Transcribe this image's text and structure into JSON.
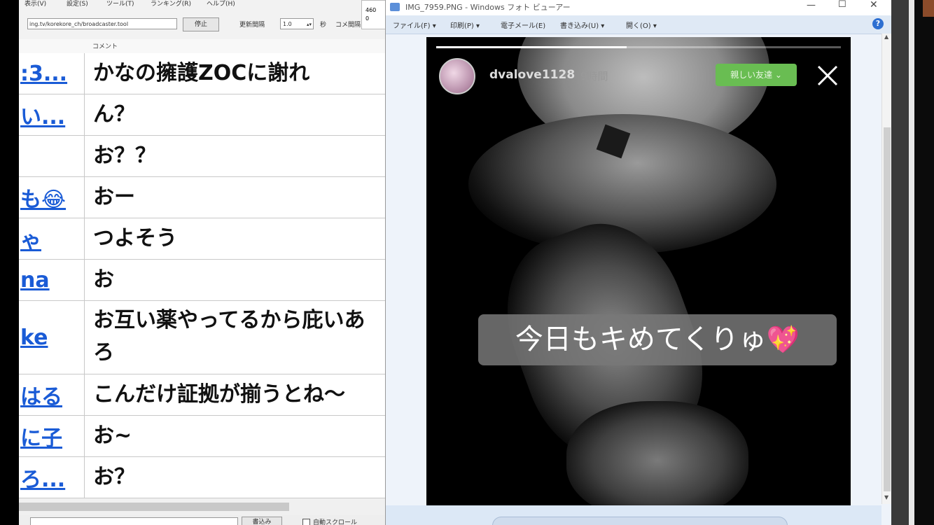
{
  "left_app": {
    "menu": [
      "表示(V)",
      "設定(S)",
      "ツール(T)",
      "ランキング(R)",
      "ヘルプ(H)"
    ],
    "toolbar": {
      "url": "ing.tv/korekore_ch/broadcaster.tool",
      "stop_label": "停止",
      "refresh_label": "更新間隔",
      "interval_value": "1.0",
      "seconds_label": "秒",
      "comment_count_label": "コメ間隔",
      "counter_lines": [
        "460",
        "0"
      ]
    },
    "table": {
      "header_comment": "コメント",
      "rows": [
        {
          "name": ":3...",
          "comment": "かなの擁護ZOCに謝れ"
        },
        {
          "name": "い...",
          "comment": "ん？"
        },
        {
          "name": "",
          "comment": "お？？"
        },
        {
          "name": "も😂",
          "comment": "おー"
        },
        {
          "name": "ゃ",
          "comment": "つよそう"
        },
        {
          "name": "na",
          "comment": "お"
        },
        {
          "name": "ke",
          "comment": "お互い薬やってるから庇いあろ"
        },
        {
          "name": "はる",
          "comment": "こんだけ証拠が揃うとね～"
        },
        {
          "name": "に子",
          "comment": "お~"
        },
        {
          "name": "ろ...",
          "comment": "お？"
        }
      ]
    },
    "bottom": {
      "write_label": "書込み",
      "auto_label": "自動スクロール"
    }
  },
  "photo_viewer": {
    "window_title": "IMG_7959.PNG - Windows フォト ビューアー",
    "menu": [
      "ファイル(F) ▾",
      "印刷(P) ▾",
      "電子メール(E)",
      "書き込み(U) ▾",
      "開く(O) ▾"
    ],
    "help": "?"
  },
  "story": {
    "username": "dvalove1128",
    "time": "9時間",
    "badge": "親しい友達 ⌄",
    "caption": "今日もキめてくりゅ",
    "caption_emoji": "💖",
    "progress": 0.47
  }
}
